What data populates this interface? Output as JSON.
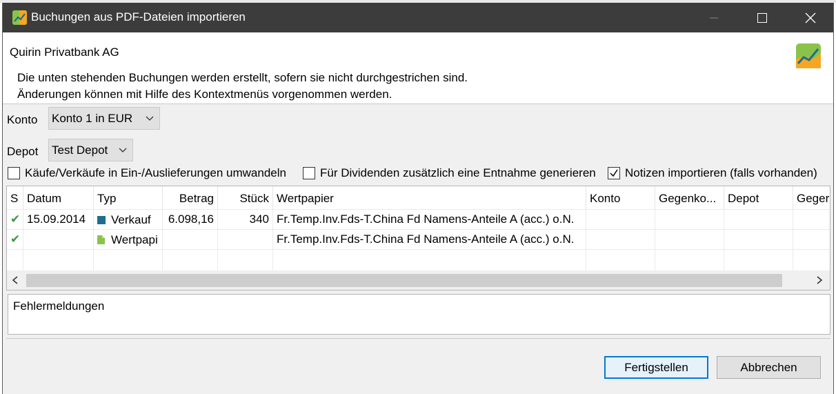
{
  "window": {
    "title": "Buchungen aus PDF-Dateien importieren"
  },
  "header": {
    "title": "Quirin Privatbank AG",
    "message_line1": "Die unten stehenden Buchungen werden erstellt, sofern sie nicht durchgestrichen sind.",
    "message_line2": "Änderungen können mit Hilfe des Kontextmenüs vorgenommen werden."
  },
  "konto": {
    "label": "Konto",
    "value": "Konto 1 in EUR"
  },
  "depot": {
    "label": "Depot",
    "value": "Test Depot"
  },
  "options": [
    {
      "label": "Käufe/Verkäufe in Ein-/Auslieferungen umwandeln",
      "checked": false
    },
    {
      "label": "Für Dividenden zusätzlich eine Entnahme generieren",
      "checked": false
    },
    {
      "label": "Notizen importieren (falls vorhanden)",
      "checked": true
    }
  ],
  "table": {
    "columns": [
      "S",
      "Datum",
      "Typ",
      "Betrag",
      "Stück",
      "Wertpapier",
      "Konto",
      "Gegenko...",
      "Depot",
      "Geger"
    ],
    "rows": [
      {
        "status": "✔",
        "datum": "15.09.2014",
        "typ": "Verkauf",
        "typ_icon": "transaction-icon",
        "betrag": "6.098,16",
        "stueck": "340",
        "wertpapier": "Fr.Temp.Inv.Fds-T.China Fd Namens-Anteile A (acc.) o.N.",
        "konto": "",
        "gegenkonto": "",
        "depot": "",
        "gegendepot": ""
      },
      {
        "status": "✔",
        "datum": "",
        "typ": "Wertpapi",
        "typ_icon": "document-icon",
        "betrag": "",
        "stueck": "",
        "wertpapier": "Fr.Temp.Inv.Fds-T.China Fd Namens-Anteile A (acc.) o.N.",
        "konto": "",
        "gegenkonto": "",
        "depot": "",
        "gegendepot": ""
      }
    ]
  },
  "errors": {
    "label": "Fehlermeldungen"
  },
  "buttons": {
    "finish": "Fertigstellen",
    "cancel": "Abbrechen"
  },
  "colors": {
    "titlebar": "#3c3c3c",
    "check_green": "#3c9a3c",
    "transaction_icon": "#1e6e8c",
    "document_icon": "#8bc34a",
    "primary_border": "#0078d7"
  }
}
